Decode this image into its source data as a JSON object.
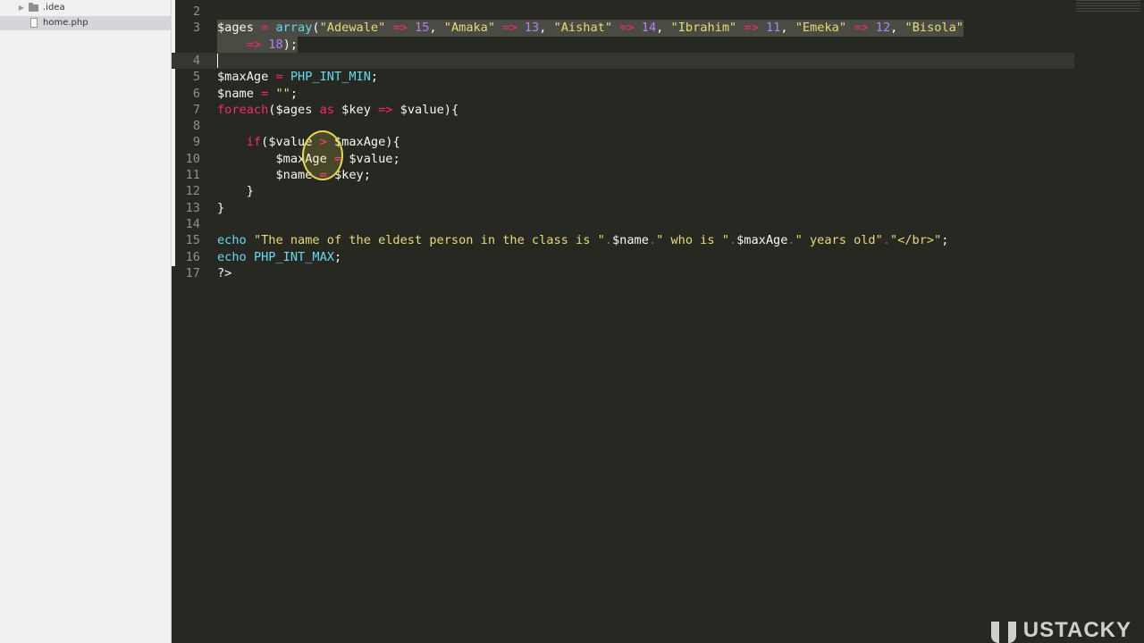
{
  "sidebar": {
    "items": [
      {
        "label": ".idea",
        "type": "folder"
      },
      {
        "label": "home.php",
        "type": "file",
        "selected": true
      }
    ]
  },
  "editor": {
    "lines": [
      {
        "num": "2",
        "tokens": []
      },
      {
        "num": "3",
        "tokens": [
          [
            "$ages",
            "v"
          ],
          [
            " ",
            "p"
          ],
          [
            "=",
            "o"
          ],
          [
            " ",
            "p"
          ],
          [
            "array",
            "c"
          ],
          [
            "(",
            "p"
          ],
          [
            "\"Adewale\"",
            "s"
          ],
          [
            " ",
            "p"
          ],
          [
            "=>",
            "o"
          ],
          [
            " ",
            "p"
          ],
          [
            "15",
            "n"
          ],
          [
            ", ",
            "p"
          ],
          [
            "\"Amaka\"",
            "s"
          ],
          [
            " ",
            "p"
          ],
          [
            "=>",
            "o"
          ],
          [
            " ",
            "p"
          ],
          [
            "13",
            "n"
          ],
          [
            ", ",
            "p"
          ],
          [
            "\"Aishat\"",
            "s"
          ],
          [
            " ",
            "p"
          ],
          [
            "=>",
            "o"
          ],
          [
            " ",
            "p"
          ],
          [
            "14",
            "n"
          ],
          [
            ", ",
            "p"
          ],
          [
            "\"Ibrahim\"",
            "s"
          ],
          [
            " ",
            "p"
          ],
          [
            "=>",
            "o"
          ],
          [
            " ",
            "p"
          ],
          [
            "11",
            "n"
          ],
          [
            ", ",
            "p"
          ],
          [
            "\"Emeka\"",
            "s"
          ],
          [
            " ",
            "p"
          ],
          [
            "=>",
            "o"
          ],
          [
            " ",
            "p"
          ],
          [
            "12",
            "n"
          ],
          [
            ", ",
            "p"
          ],
          [
            "\"Bisola\"",
            "s"
          ]
        ],
        "selected": true
      },
      {
        "num": "",
        "tokens": [
          [
            "    ",
            "p"
          ],
          [
            "=>",
            "o"
          ],
          [
            " ",
            "p"
          ],
          [
            "18",
            "n"
          ],
          [
            ");",
            "p"
          ]
        ],
        "selected": true
      },
      {
        "num": "4",
        "tokens": [],
        "caret": true
      },
      {
        "num": "5",
        "tokens": [
          [
            "$maxAge",
            "v"
          ],
          [
            " ",
            "p"
          ],
          [
            "=",
            "o"
          ],
          [
            " ",
            "p"
          ],
          [
            "PHP_INT_MIN",
            "c"
          ],
          [
            ";",
            "p"
          ]
        ]
      },
      {
        "num": "6",
        "tokens": [
          [
            "$name",
            "v"
          ],
          [
            " ",
            "p"
          ],
          [
            "=",
            "o"
          ],
          [
            " ",
            "p"
          ],
          [
            "\"\"",
            "s"
          ],
          [
            ";",
            "p"
          ]
        ]
      },
      {
        "num": "7",
        "tokens": [
          [
            "foreach",
            "k"
          ],
          [
            "(",
            "p"
          ],
          [
            "$ages",
            "v"
          ],
          [
            " ",
            "p"
          ],
          [
            "as",
            "k"
          ],
          [
            " ",
            "p"
          ],
          [
            "$key",
            "v"
          ],
          [
            " ",
            "p"
          ],
          [
            "=>",
            "o"
          ],
          [
            " ",
            "p"
          ],
          [
            "$value",
            "v"
          ],
          [
            "){",
            "p"
          ]
        ]
      },
      {
        "num": "8",
        "tokens": []
      },
      {
        "num": "9",
        "tokens": [
          [
            "    ",
            "p"
          ],
          [
            "if",
            "k"
          ],
          [
            "(",
            "p"
          ],
          [
            "$value",
            "v"
          ],
          [
            " ",
            "p"
          ],
          [
            ">",
            "o"
          ],
          [
            " ",
            "p"
          ],
          [
            "$maxAge",
            "v"
          ],
          [
            "){",
            "p"
          ]
        ]
      },
      {
        "num": "10",
        "tokens": [
          [
            "        ",
            "p"
          ],
          [
            "$maxAge",
            "v"
          ],
          [
            " ",
            "p"
          ],
          [
            "=",
            "o"
          ],
          [
            " ",
            "p"
          ],
          [
            "$value",
            "v"
          ],
          [
            ";",
            "p"
          ]
        ]
      },
      {
        "num": "11",
        "tokens": [
          [
            "        ",
            "p"
          ],
          [
            "$name",
            "v"
          ],
          [
            " ",
            "p"
          ],
          [
            "=",
            "o"
          ],
          [
            " ",
            "p"
          ],
          [
            "$key",
            "v"
          ],
          [
            ";",
            "p"
          ]
        ]
      },
      {
        "num": "12",
        "tokens": [
          [
            "    ",
            "p"
          ],
          [
            "}",
            "p"
          ]
        ]
      },
      {
        "num": "13",
        "tokens": [
          [
            "}",
            "p"
          ]
        ]
      },
      {
        "num": "14",
        "tokens": []
      },
      {
        "num": "15",
        "tokens": [
          [
            "echo",
            "c"
          ],
          [
            " ",
            "p"
          ],
          [
            "\"The name of the eldest person in the class is \"",
            "s"
          ],
          [
            ".",
            "o"
          ],
          [
            "$name",
            "v"
          ],
          [
            ".",
            "o"
          ],
          [
            "\" who is \"",
            "s"
          ],
          [
            ".",
            "o"
          ],
          [
            "$maxAge",
            "v"
          ],
          [
            ".",
            "o"
          ],
          [
            "\" years old\"",
            "s"
          ],
          [
            ".",
            "o"
          ],
          [
            "\"</br>\"",
            "s"
          ],
          [
            ";",
            "p"
          ]
        ]
      },
      {
        "num": "16",
        "tokens": [
          [
            "echo",
            "c"
          ],
          [
            " ",
            "p"
          ],
          [
            "PHP_INT_MAX",
            "c"
          ],
          [
            ";",
            "p"
          ]
        ]
      },
      {
        "num": "17",
        "tokens": [
          [
            "?>",
            "p"
          ]
        ]
      }
    ]
  },
  "watermark": {
    "text": "USTACKY"
  },
  "colors": {
    "editor_bg": "#272822",
    "keyword": "#f92672",
    "string": "#e6db74",
    "number": "#ae81ff",
    "constant": "#66d9ef"
  }
}
